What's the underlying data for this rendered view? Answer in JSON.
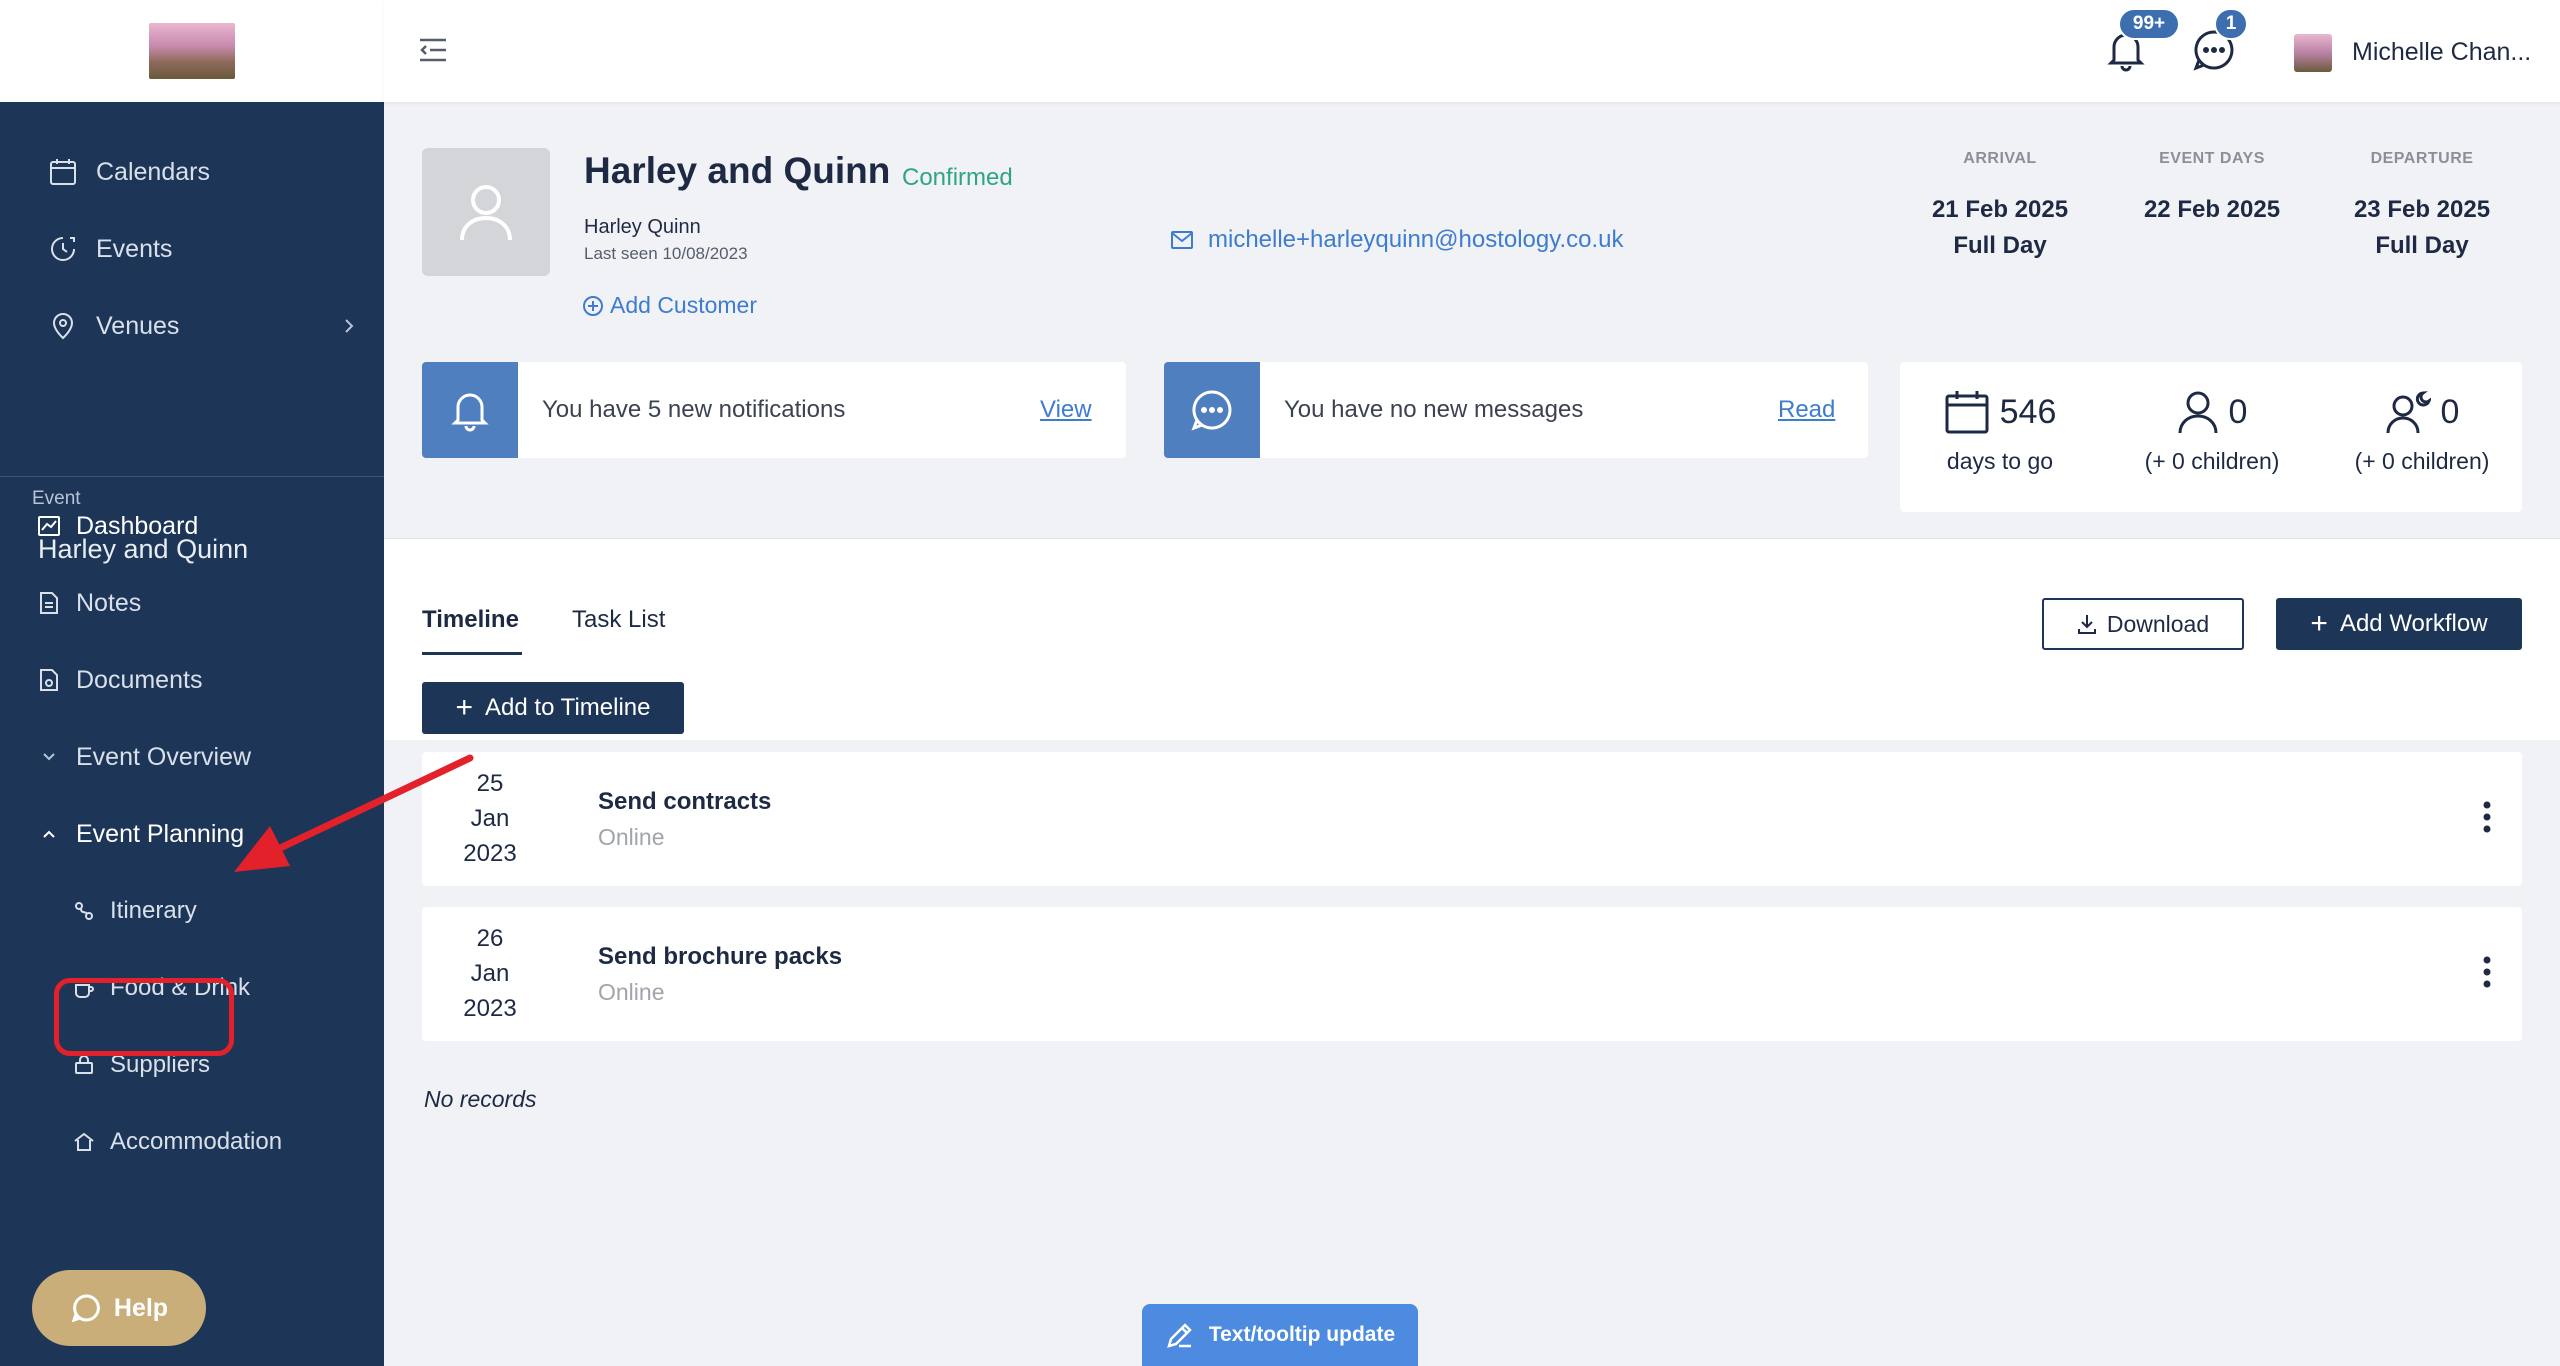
{
  "header": {
    "notif_badge": "99+",
    "msg_badge": "1",
    "user_name": "Michelle Chan..."
  },
  "sidebar": {
    "top_items": [
      {
        "label": "Calendars",
        "icon": "calendar-icon"
      },
      {
        "label": "Events",
        "icon": "events-icon"
      },
      {
        "label": "Venues",
        "icon": "location-pin-icon"
      }
    ],
    "event_label": "Event",
    "event_name": "Harley and Quinn",
    "items": [
      {
        "label": "Dashboard",
        "icon": "chart-icon"
      },
      {
        "label": "Notes",
        "icon": "note-icon"
      },
      {
        "label": "Documents",
        "icon": "documents-icon"
      },
      {
        "label": "Event Overview",
        "icon": "chevron-down-icon"
      },
      {
        "label": "Event Planning",
        "icon": "chevron-up-icon"
      }
    ],
    "sub_items": [
      {
        "label": "Itinerary",
        "icon": "itinerary-icon"
      },
      {
        "label": "Food & Drink",
        "icon": "coffee-icon"
      },
      {
        "label": "Suppliers",
        "icon": "bag-icon"
      },
      {
        "label": "Accommodation",
        "icon": "home-icon"
      }
    ],
    "help": "Help"
  },
  "customer": {
    "title": "Harley and Quinn",
    "status": "Confirmed",
    "name": "Harley Quinn",
    "last_seen": "Last seen 10/08/2023",
    "add_customer": "Add Customer",
    "email": "michelle+harleyquinn@hostology.co.uk"
  },
  "dates": {
    "arrival_label": "ARRIVAL",
    "arrival_date": "21 Feb 2025",
    "arrival_type": "Full Day",
    "event_days_label": "EVENT DAYS",
    "event_days_date": "22 Feb 2025",
    "departure_label": "DEPARTURE",
    "departure_date": "23 Feb 2025",
    "departure_type": "Full Day"
  },
  "cards": {
    "notifications_text": "You have 5 new notifications",
    "notifications_link": "View",
    "messages_text": "You have no new messages",
    "messages_link": "Read"
  },
  "stats": {
    "days": "546",
    "days_label": "days to go",
    "adults": "0",
    "adults_children": "(+ 0 children)",
    "nights": "0",
    "nights_children": "(+ 0 children)"
  },
  "timeline": {
    "tabs": [
      "Timeline",
      "Task List"
    ],
    "download": "Download",
    "add_workflow": "Add Workflow",
    "add_to_timeline": "Add to Timeline",
    "items": [
      {
        "day": "25",
        "month": "Jan",
        "year": "2023",
        "title": "Send contracts",
        "subtitle": "Online"
      },
      {
        "day": "26",
        "month": "Jan",
        "year": "2023",
        "title": "Send brochure packs",
        "subtitle": "Online"
      }
    ],
    "no_records": "No records"
  },
  "tooltip_update": "Text/tooltip update",
  "colors": {
    "sidebar": "#1d3557",
    "accent_blue": "#4f7fbf",
    "confirmed": "#2fa583",
    "help": "#c9ae7a",
    "annotation_red": "#e3212a"
  }
}
